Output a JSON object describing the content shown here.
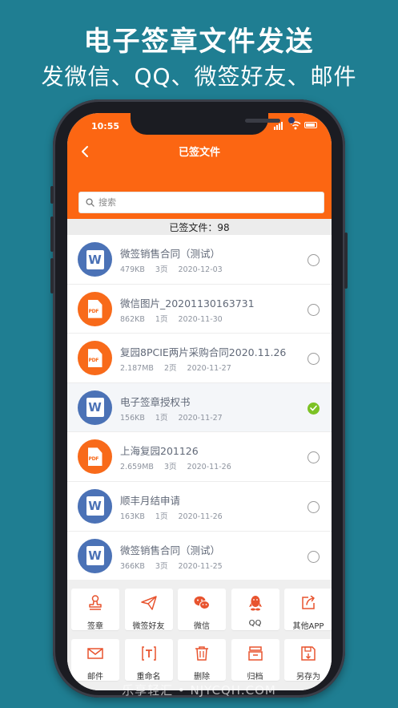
{
  "promo": {
    "headline": "电子签章文件发送",
    "subheadline": "发微信、QQ、微签好友、邮件"
  },
  "status_bar": {
    "time": "10:55"
  },
  "header": {
    "title": "已签文件"
  },
  "search": {
    "placeholder": "搜索"
  },
  "summary": {
    "label": "已签文件：98"
  },
  "files": [
    {
      "name": "微签销售合同（测试）",
      "size": "479KB",
      "pages": "3页",
      "date": "2020-12-03",
      "type": "word",
      "selected": false
    },
    {
      "name": "微信图片_20201130163731",
      "size": "862KB",
      "pages": "1页",
      "date": "2020-11-30",
      "type": "pdf",
      "selected": false
    },
    {
      "name": "复园8PCIE两片采购合同2020.11.26",
      "size": "2.187MB",
      "pages": "2页",
      "date": "2020-11-27",
      "type": "pdf",
      "selected": false
    },
    {
      "name": "电子签章授权书",
      "size": "156KB",
      "pages": "1页",
      "date": "2020-11-27",
      "type": "word",
      "selected": true
    },
    {
      "name": "上海复园201126",
      "size": "2.659MB",
      "pages": "3页",
      "date": "2020-11-26",
      "type": "pdf",
      "selected": false
    },
    {
      "name": "顺丰月结申请",
      "size": "163KB",
      "pages": "1页",
      "date": "2020-11-26",
      "type": "word",
      "selected": false
    },
    {
      "name": "微签销售合同（测试）",
      "size": "366KB",
      "pages": "3页",
      "date": "2020-11-25",
      "type": "word",
      "selected": false
    }
  ],
  "file_icons": {
    "word": "W",
    "pdf": "PDF"
  },
  "actions": [
    {
      "label": "签章",
      "icon": "stamp-icon"
    },
    {
      "label": "微签好友",
      "icon": "paper-plane-icon"
    },
    {
      "label": "微信",
      "icon": "wechat-icon"
    },
    {
      "label": "QQ",
      "icon": "qq-icon"
    },
    {
      "label": "其他APP",
      "icon": "share-icon"
    },
    {
      "label": "邮件",
      "icon": "mail-icon"
    },
    {
      "label": "重命名",
      "icon": "rename-icon"
    },
    {
      "label": "删除",
      "icon": "trash-icon"
    },
    {
      "label": "归档",
      "icon": "archive-icon"
    },
    {
      "label": "另存为",
      "icon": "save-as-icon"
    }
  ],
  "watermark": "乐享轻汇 • NJYCQH.COM",
  "colors": {
    "background": "#1f7e92",
    "accent": "#fc6612",
    "word_blue": "#4b72b6",
    "pdf_orange": "#f86a1a",
    "selected_green": "#7cc225",
    "action_red": "#e8542f"
  }
}
